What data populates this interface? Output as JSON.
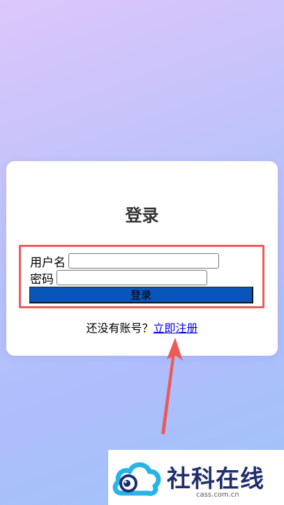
{
  "login": {
    "title": "登录",
    "username_label": "用户名",
    "username_value": "",
    "password_label": "密码",
    "password_value": "",
    "submit_label": "登录",
    "register_prompt": "还没有账号？",
    "register_link": "立即注册"
  },
  "annotations": {
    "highlight_color": "#ec5a5a",
    "arrow_color": "#ec5a5a"
  },
  "watermark": {
    "brand": "社科在线",
    "url": "cass.com.cn",
    "logo_icon": "cloud-eye-logo"
  },
  "colors": {
    "button": "#0a55b8",
    "link": "#0000ee",
    "brand_text": "#1f2f6e",
    "logo_cloud": "#29b4e8"
  }
}
